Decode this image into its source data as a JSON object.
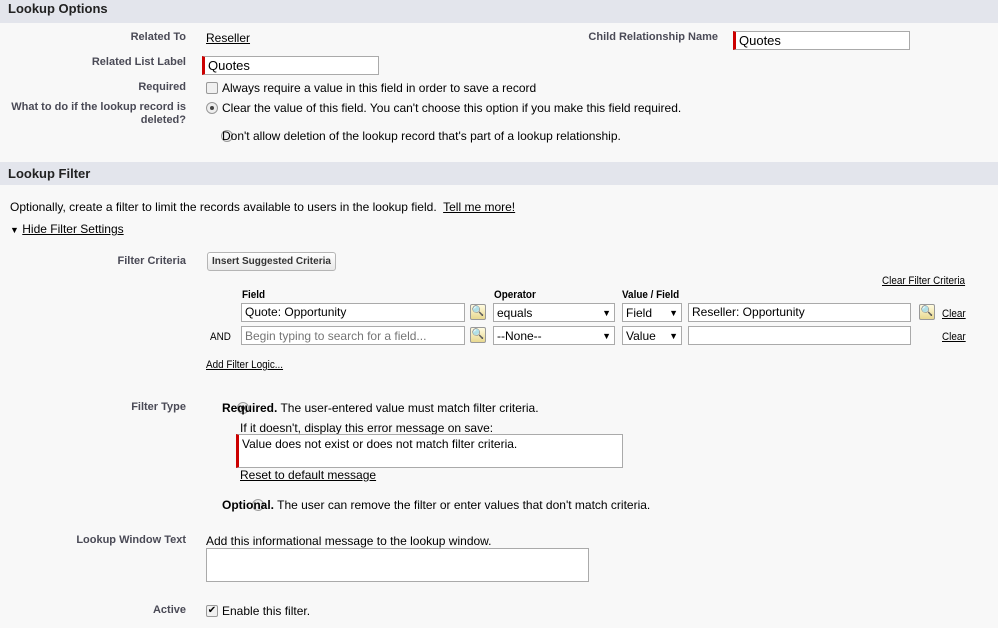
{
  "lookup_options": {
    "title": "Lookup Options",
    "related_to_label": "Related To",
    "related_to_value": "Reseller",
    "child_rel_label": "Child Relationship Name",
    "child_rel_value": "Quotes",
    "related_list_label": "Related List Label",
    "related_list_value": "Quotes",
    "required_label": "Required",
    "required_text": "Always require a value in this field in order to save a record",
    "delete_label": "What to do if the lookup record is deleted?",
    "delete_opt1": "Clear the value of this field. You can't choose this option if you make this field required.",
    "delete_opt2": "Don't allow deletion of the lookup record that's part of a lookup relationship."
  },
  "lookup_filter": {
    "title": "Lookup Filter",
    "intro": "Optionally, create a filter to limit the records available to users in the lookup field.",
    "tell_more": "Tell me more!",
    "hide_settings": "Hide Filter Settings",
    "criteria_label": "Filter Criteria",
    "insert_btn": "Insert Suggested Criteria",
    "clear_criteria": "Clear Filter Criteria",
    "col_field": "Field",
    "col_operator": "Operator",
    "col_value": "Value / Field",
    "rows": [
      {
        "prefix": "",
        "field": "Quote: Opportunity",
        "operator": "equals",
        "type": "Field",
        "value": "Reseller: Opportunity",
        "clear": "Clear"
      },
      {
        "prefix": "AND",
        "field_placeholder": "Begin typing to search for a field...",
        "operator": "--None--",
        "type": "Value",
        "value": "",
        "clear": "Clear"
      }
    ],
    "add_logic": "Add Filter Logic...",
    "filter_type_label": "Filter Type",
    "required_bold": "Required.",
    "required_desc": "The user-entered value must match filter criteria.",
    "error_prompt": "If it doesn't, display this error message on save:",
    "error_message": "Value does not exist or does not match filter criteria.",
    "reset": "Reset to default message",
    "optional_bold": "Optional.",
    "optional_desc": "The user can remove the filter or enter values that don't match criteria.",
    "window_text_label": "Lookup Window Text",
    "window_text_desc": "Add this informational message to the lookup window.",
    "active_label": "Active",
    "active_text": "Enable this filter."
  }
}
